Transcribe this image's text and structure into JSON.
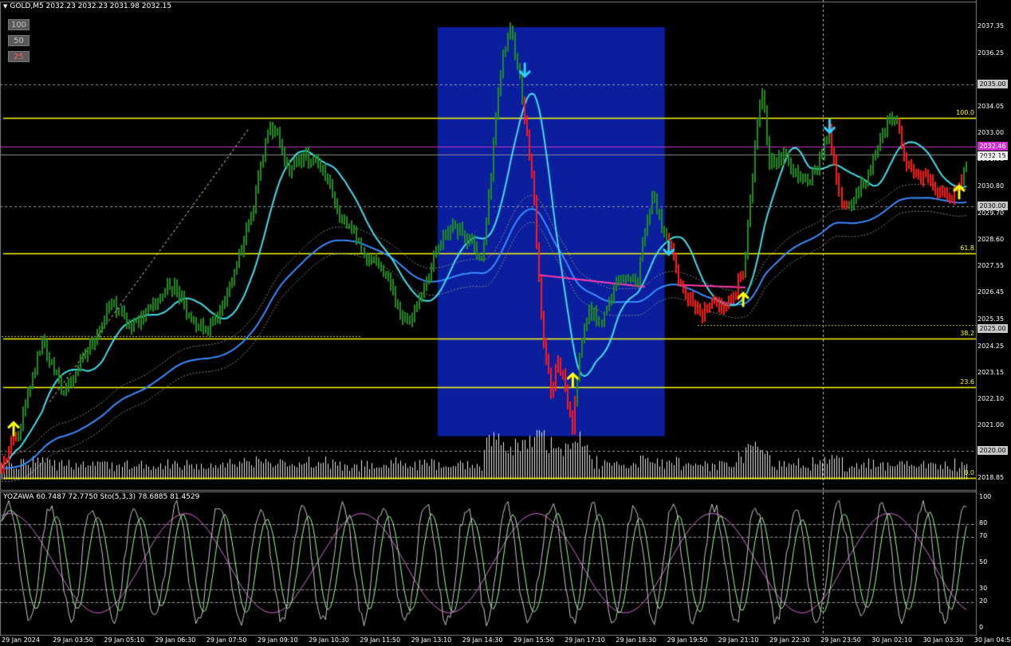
{
  "header": {
    "symbol": "GOLD,M5",
    "ohlc": "2032.23 2032.23 2031.98 2032.15",
    "indicator": "YOZAWA 60.7487 72.7750",
    "stoch": "Sto(5,3,3) 78.6885 81.4529"
  },
  "zoom_buttons": [
    {
      "label": "100",
      "active": false
    },
    {
      "label": "50",
      "active": false
    },
    {
      "label": "25",
      "active": true
    }
  ],
  "colors": {
    "background": "#000000",
    "bull": "#228b22",
    "bear": "#ff1a1a",
    "zone": "#0a1e9e",
    "fib": "#ffff00",
    "ema_fast": "#40e0e8",
    "ema_slow": "#3a8cff",
    "pink_line": "#ff3fae",
    "magenta_line": "#cc33cc",
    "arrow_up": "#ffff00",
    "arrow_down": "#30d0ff",
    "stoch_main": "#c8c8c8",
    "stoch_signal": "#e070e0",
    "stoch_green": "#a0ffa0"
  },
  "price_axis": {
    "ylim": [
      2018.4,
      2038.4
    ],
    "labels": [
      "2037.35",
      "2036.25",
      "2035.00",
      "2034.05",
      "2033.00",
      "2032.46",
      "2032.15",
      "2031.90",
      "2030.80",
      "2030.00",
      "2029.70",
      "2028.60",
      "2027.55",
      "2026.45",
      "2025.35",
      "2025.00",
      "2024.25",
      "2023.15",
      "2022.10",
      "2021.00",
      "2020.00",
      "2018.85"
    ],
    "current_price": "2032.15",
    "ask_price": "2032.46"
  },
  "sub_axis": {
    "labels": [
      "100",
      "80",
      "70",
      "50",
      "30",
      "20",
      "0"
    ]
  },
  "time_axis": {
    "labels": [
      "29 Jan 2024",
      "29 Jan 03:50",
      "29 Jan 05:10",
      "29 Jan 06:30",
      "29 Jan 07:50",
      "29 Jan 09:10",
      "29 Jan 10:30",
      "29 Jan 11:50",
      "29 Jan 13:10",
      "29 Jan 14:30",
      "29 Jan 15:50",
      "29 Jan 17:10",
      "29 Jan 18:30",
      "29 Jan 19:50",
      "29 Jan 21:10",
      "29 Jan 22:30",
      "29 Jan 23:50",
      "30 Jan 02:10",
      "30 Jan 03:30",
      "30 Jan 04:50"
    ]
  },
  "fib_levels": [
    {
      "label": "100.0",
      "price": 2033.65
    },
    {
      "label": "61.8",
      "price": 2028.1
    },
    {
      "label": "38.2",
      "price": 2024.6
    },
    {
      "label": "23.6",
      "price": 2022.6
    },
    {
      "label": "0.0",
      "price": 2018.9
    }
  ],
  "chart_data": {
    "type": "candlestick",
    "symbol": "GOLD",
    "timeframe": "M5",
    "ylim": [
      2018.4,
      2038.4
    ],
    "close_keypoints": [
      [
        0,
        2019.3
      ],
      [
        8,
        2021.0
      ],
      [
        12,
        2022.6
      ],
      [
        17,
        2024.6
      ],
      [
        22,
        2023.2
      ],
      [
        26,
        2022.4
      ],
      [
        32,
        2023.4
      ],
      [
        40,
        2024.8
      ],
      [
        46,
        2026.1
      ],
      [
        54,
        2025.0
      ],
      [
        60,
        2025.7
      ],
      [
        68,
        2026.5
      ],
      [
        72,
        2026.9
      ],
      [
        76,
        2026.0
      ],
      [
        82,
        2025.1
      ],
      [
        86,
        2024.9
      ],
      [
        92,
        2025.9
      ],
      [
        98,
        2027.6
      ],
      [
        104,
        2029.6
      ],
      [
        108,
        2031.7
      ],
      [
        112,
        2033.3
      ],
      [
        116,
        2032.6
      ],
      [
        120,
        2031.4
      ],
      [
        126,
        2032.1
      ],
      [
        132,
        2031.8
      ],
      [
        136,
        2031.1
      ],
      [
        140,
        2029.9
      ],
      [
        144,
        2029.2
      ],
      [
        150,
        2028.2
      ],
      [
        156,
        2027.7
      ],
      [
        162,
        2026.8
      ],
      [
        166,
        2025.6
      ],
      [
        170,
        2025.3
      ],
      [
        176,
        2026.8
      ],
      [
        182,
        2028.3
      ],
      [
        188,
        2029.3
      ],
      [
        192,
        2028.9
      ],
      [
        196,
        2028.6
      ],
      [
        200,
        2027.9
      ],
      [
        204,
        2031.2
      ],
      [
        206,
        2033.8
      ],
      [
        209,
        2036.3
      ],
      [
        212,
        2037.3
      ],
      [
        214,
        2036.2
      ],
      [
        216,
        2035.4
      ],
      [
        218,
        2033.6
      ],
      [
        221,
        2031.4
      ],
      [
        224,
        2027.1
      ],
      [
        226,
        2024.4
      ],
      [
        229,
        2022.3
      ],
      [
        232,
        2023.7
      ],
      [
        235,
        2022.6
      ],
      [
        238,
        2020.9
      ],
      [
        241,
        2023.9
      ],
      [
        245,
        2025.9
      ],
      [
        249,
        2025.3
      ],
      [
        252,
        2025.8
      ],
      [
        256,
        2026.9
      ],
      [
        260,
        2027.1
      ],
      [
        265,
        2027.0
      ],
      [
        268,
        2028.9
      ],
      [
        271,
        2030.4
      ],
      [
        274,
        2029.7
      ],
      [
        278,
        2028.4
      ],
      [
        281,
        2027.4
      ],
      [
        284,
        2026.6
      ],
      [
        288,
        2026.0
      ],
      [
        292,
        2025.4
      ],
      [
        296,
        2026.1
      ],
      [
        301,
        2025.8
      ],
      [
        305,
        2026.4
      ],
      [
        309,
        2027.3
      ],
      [
        312,
        2030.3
      ],
      [
        315,
        2033.4
      ],
      [
        317,
        2034.7
      ],
      [
        320,
        2031.7
      ],
      [
        324,
        2032.1
      ],
      [
        328,
        2031.9
      ],
      [
        332,
        2031.1
      ],
      [
        336,
        2031.0
      ],
      [
        340,
        2031.5
      ],
      [
        343,
        2032.7
      ],
      [
        345,
        2033.2
      ],
      [
        347,
        2031.9
      ],
      [
        350,
        2030.1
      ],
      [
        353,
        2030.1
      ],
      [
        357,
        2030.6
      ],
      [
        361,
        2031.4
      ],
      [
        365,
        2032.4
      ],
      [
        369,
        2033.6
      ],
      [
        373,
        2033.5
      ],
      [
        376,
        2032.1
      ],
      [
        380,
        2031.3
      ],
      [
        384,
        2031.3
      ],
      [
        388,
        2030.8
      ],
      [
        392,
        2030.5
      ],
      [
        396,
        2030.3
      ],
      [
        399,
        2030.8
      ],
      [
        402,
        2031.7
      ]
    ],
    "arrows": [
      {
        "dir": "up",
        "bar": 5,
        "price": 2020.9
      },
      {
        "dir": "down",
        "bar": 218,
        "price": 2035.6
      },
      {
        "dir": "up",
        "bar": 238,
        "price": 2022.9
      },
      {
        "dir": "down",
        "bar": 278,
        "price": 2028.3
      },
      {
        "dir": "up",
        "bar": 309,
        "price": 2026.2
      },
      {
        "dir": "down",
        "bar": 345,
        "price": 2033.3
      },
      {
        "dir": "up",
        "bar": 399,
        "price": 2030.6
      }
    ],
    "highlight_zone": {
      "from_bar": 182,
      "to_bar": 276,
      "price_range": [
        2020.6,
        2037.35
      ]
    },
    "horizontal_lines": {
      "ask": 2032.46,
      "bid": 2032.15,
      "dashed": [
        2035.0,
        2030.0,
        2020.0
      ]
    },
    "stochastic": {
      "k": 78.6885,
      "d": 81.4529,
      "levels": [
        100,
        80,
        70,
        50,
        30,
        20,
        0
      ]
    }
  }
}
